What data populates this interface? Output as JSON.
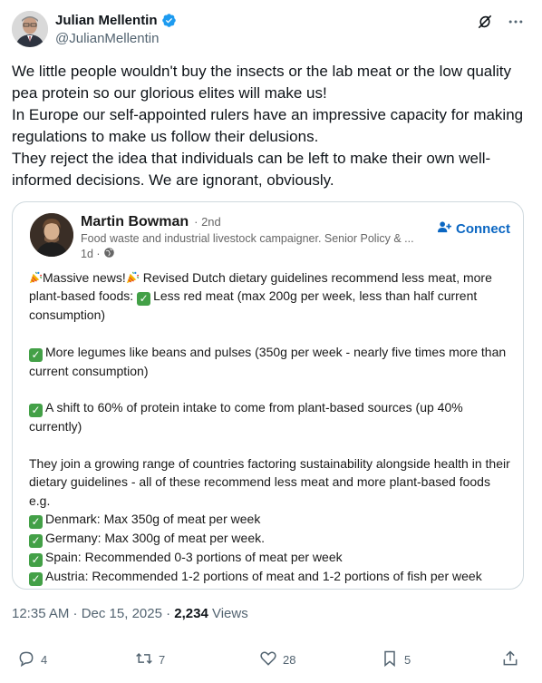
{
  "author": {
    "name": "Julian Mellentin",
    "handle": "@JulianMellentin"
  },
  "tweet_text": [
    "We little people wouldn't buy the insects or the lab meat or the low quality pea protein so our glorious elites will make us!",
    "In Europe our self-appointed rulers have an impressive capacity for making regulations to make us follow their delusions.",
    "They reject the idea that individuals can be left to make their own well-informed decisions. We are ignorant, obviously."
  ],
  "embedded_post": {
    "name": "Martin Bowman",
    "degree": "· 2nd",
    "headline": "Food waste and industrial livestock campaigner. Senior Policy & ...",
    "time": "1d ·",
    "connect_label": "Connect",
    "intro_a": "Massive news!",
    "intro_b": " Revised Dutch dietary guidelines recommend less meat, more plant-based foods: ",
    "intro_c": "Less red meat (max 200g per week, less than half current consumption)",
    "legumes": "More legumes like beans and pulses (350g per week - nearly five times more than current consumption)",
    "protein": "A shift to 60% of protein intake to come from plant-based sources (up 40% currently)",
    "range": "They join a growing range of countries factoring sustainability alongside health in their dietary guidelines - all of these recommend less meat and more plant-based foods e.g.",
    "countries": [
      "Denmark: Max 350g of meat per week",
      "Germany: Max 300g of meat per week.",
      "Spain: Recommended 0-3 portions of meat per week",
      "Austria: Recommended 1-2 portions of meat and 1-2 portions of fish per week"
    ]
  },
  "meta": {
    "time_date": "12:35 AM · Dec 15, 2025 · ",
    "views_count": "2,234",
    "views_label": " Views"
  },
  "actions": {
    "replies": "4",
    "reposts": "7",
    "likes": "28",
    "bookmarks": "5"
  },
  "icons": {
    "verified": "verified-badge-icon",
    "grok": "grok-icon",
    "more": "more-icon",
    "globe": "globe-icon",
    "connect": "add-person-icon",
    "reply": "reply-icon",
    "repost": "repost-icon",
    "like": "heart-icon",
    "bookmark": "bookmark-icon",
    "share": "share-icon"
  },
  "colors": {
    "verified": "#1d9bf0",
    "linkedin_blue": "#0a66c2",
    "check_green": "#43a047",
    "muted": "#536471"
  }
}
